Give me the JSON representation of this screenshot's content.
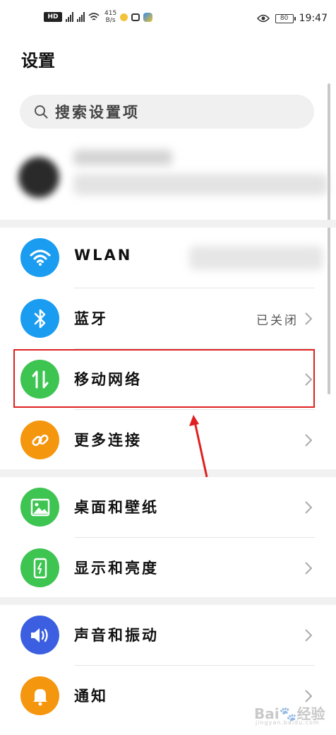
{
  "status_bar": {
    "hd_label": "HD",
    "net_speed_value": "415",
    "net_speed_unit": "B/s",
    "battery": "80",
    "time": "19:47"
  },
  "header": {
    "title": "设置"
  },
  "search": {
    "placeholder": "搜索设置项"
  },
  "rows": [
    {
      "label": "WLAN",
      "value": "",
      "icon": "wifi-icon",
      "color": "#1a9cf0"
    },
    {
      "label": "蓝牙",
      "value": "已关闭",
      "icon": "bluetooth-icon",
      "color": "#1a9cf0"
    },
    {
      "label": "移动网络",
      "value": "",
      "icon": "mobile-data-icon",
      "color": "#3dc451"
    },
    {
      "label": "更多连接",
      "value": "",
      "icon": "link-icon",
      "color": "#f5960f"
    },
    {
      "label": "桌面和壁纸",
      "value": "",
      "icon": "wallpaper-icon",
      "color": "#3dc451"
    },
    {
      "label": "显示和亮度",
      "value": "",
      "icon": "display-icon",
      "color": "#3dc451"
    },
    {
      "label": "声音和振动",
      "value": "",
      "icon": "sound-icon",
      "color": "#3b5fe0"
    },
    {
      "label": "通知",
      "value": "",
      "icon": "notification-icon",
      "color": "#f5960f"
    }
  ],
  "watermark": {
    "logo": "Bai🐾经验",
    "sub": "jingyan.baidu.com"
  }
}
